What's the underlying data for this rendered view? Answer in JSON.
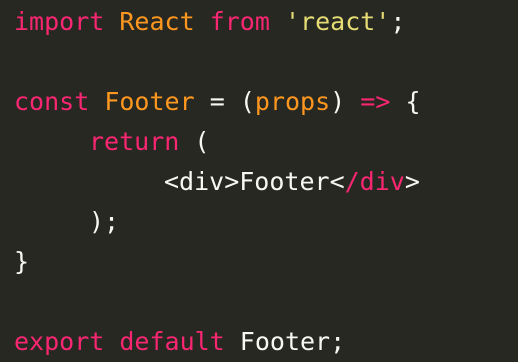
{
  "colors": {
    "background": "#272822",
    "keyword": "#f92672",
    "identifier": "#fd971f",
    "string": "#e6db74",
    "plain": "#f8f8f2"
  },
  "code": {
    "line1": {
      "kw1": "import",
      "id1": "React",
      "kw2": "from",
      "str1": "'react'",
      "p1": ";"
    },
    "line3": {
      "kw1": "const",
      "id1": "Footer",
      "p1": "=",
      "p2": "(",
      "id2": "props",
      "p3": ")",
      "kw2": "=>",
      "p4": "{"
    },
    "line4": {
      "kw1": "return",
      "p1": "("
    },
    "line5": {
      "p1": "<div>Footer<",
      "kw1": "/div",
      "p2": ">"
    },
    "line6": {
      "p1": ");"
    },
    "line7": {
      "p1": "}"
    },
    "line9": {
      "kw1": "export",
      "kw2": "default",
      "p1": "Footer;"
    }
  }
}
